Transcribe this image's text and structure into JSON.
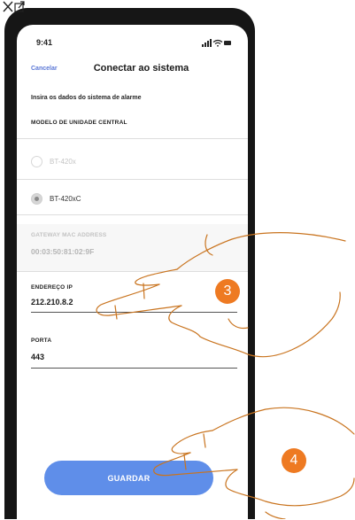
{
  "status_bar": {
    "time": "9:41"
  },
  "nav": {
    "cancel_label": "Cancelar",
    "title": "Conectar ao sistema"
  },
  "form": {
    "instruction": "Insira os dados do sistema de alarme",
    "model_section_label": "MODELO DE UNIDADE CENTRAL",
    "model_options": [
      {
        "label": "BT-420x",
        "selected": false,
        "disabled": true
      },
      {
        "label": "BT-420xC",
        "selected": true,
        "disabled": false
      }
    ],
    "gateway_mac": {
      "label": "GATEWAY MAC ADDRESS",
      "value": "00:03:50:81:02:9F"
    },
    "ip_address": {
      "label": "ENDEREÇO IP",
      "value": "212.210.8.2"
    },
    "port": {
      "label": "PORTA",
      "value": "443"
    },
    "save_label": "GUARDAR"
  },
  "steps": {
    "step_3": "3",
    "step_4": "4"
  },
  "colors": {
    "accent": "#5f8ee9",
    "link": "#5a77d6",
    "badge": "#ee7a22",
    "phone_frame": "#161616"
  },
  "icons": [
    "close-icon",
    "external-link-icon",
    "signal-icon",
    "wifi-icon",
    "battery-icon",
    "pointing-hand-icon"
  ]
}
